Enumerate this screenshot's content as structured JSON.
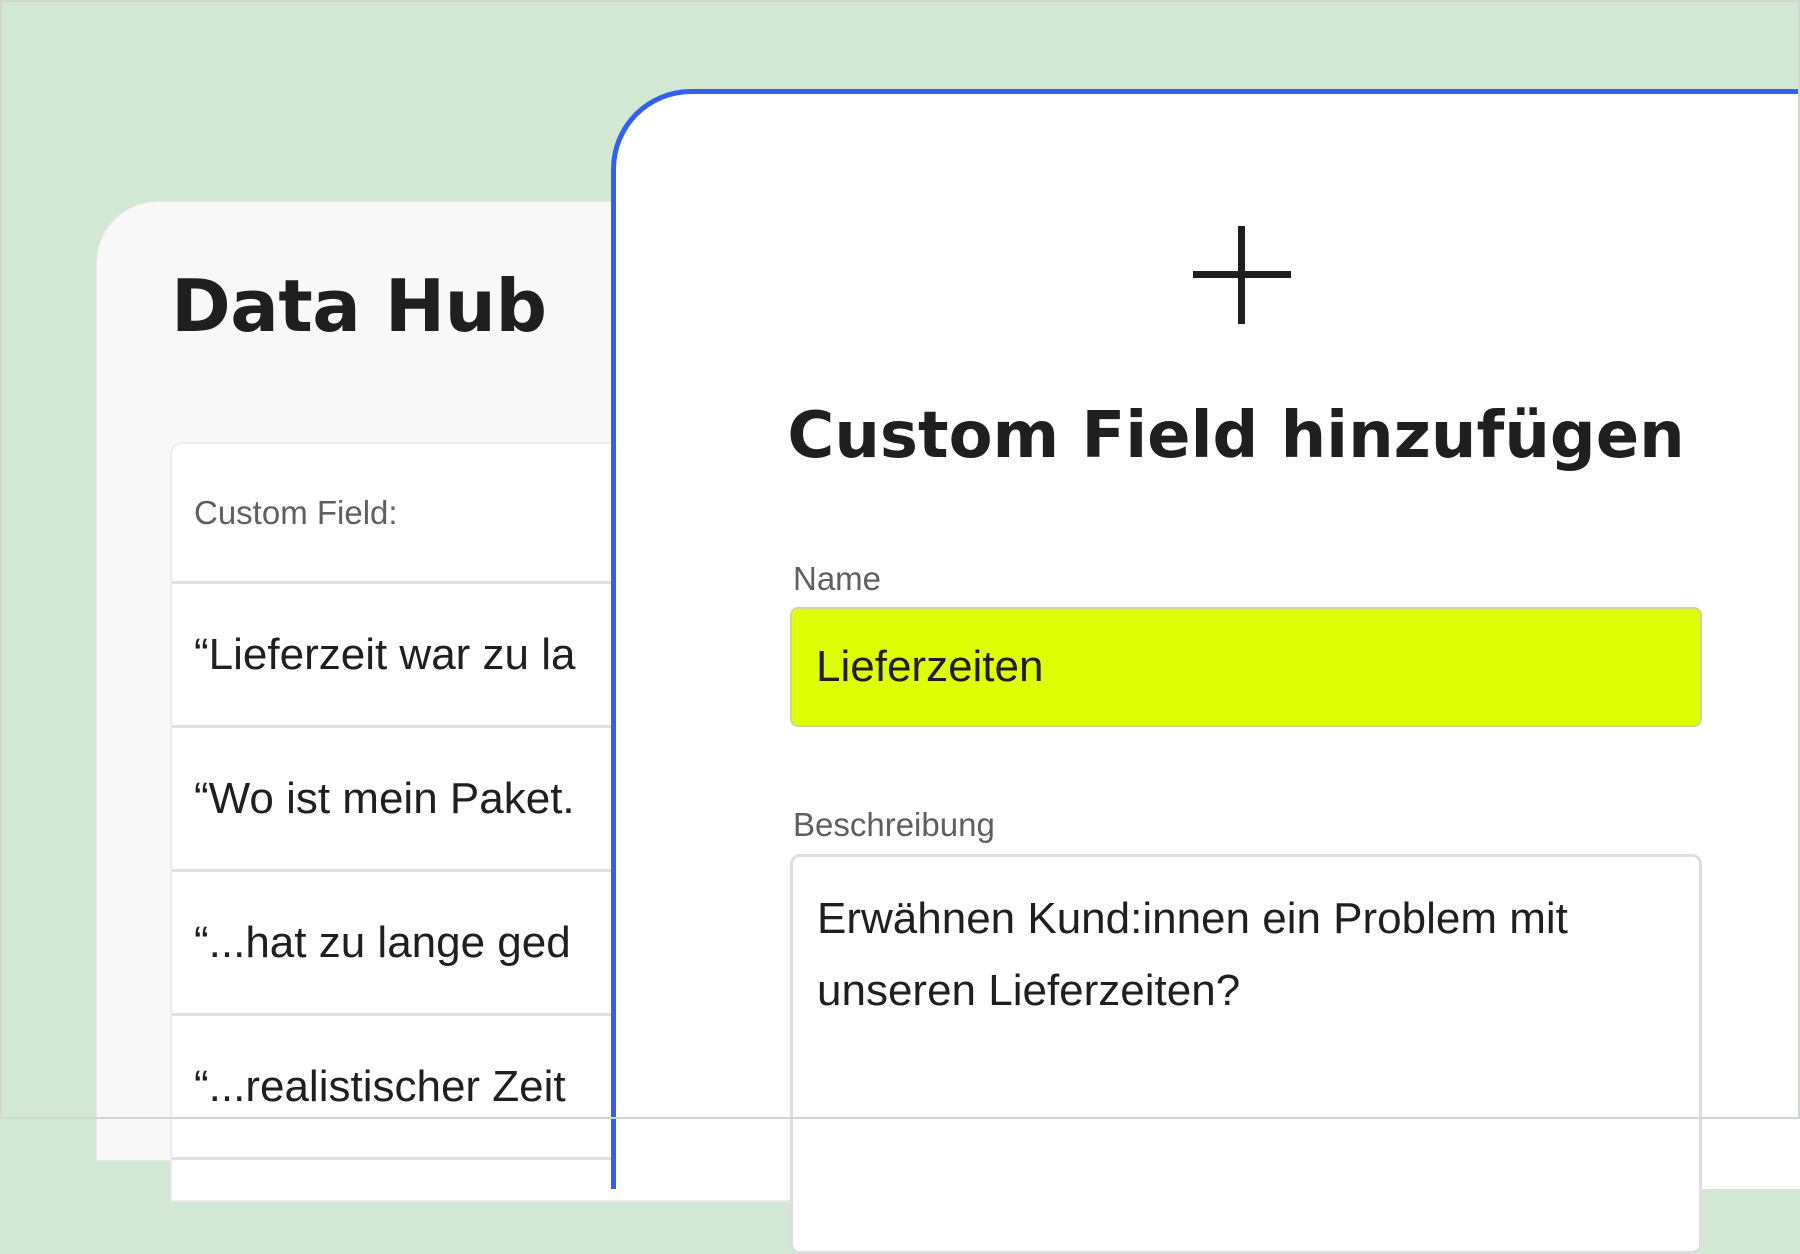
{
  "data_hub": {
    "title": "Data Hub",
    "column_header": "Custom Field:",
    "rows": [
      "“Lieferzeit war zu la",
      "“Wo ist mein Paket.",
      "“...hat zu lange ged",
      "“...realistischer Zeit"
    ]
  },
  "modal": {
    "title": "Custom Field hinzufügen",
    "name_label": "Name",
    "name_value": "Lieferzeiten",
    "description_label": "Beschreibung",
    "description_value": "Erwähnen Kund:innen ein Problem mit unseren Lieferzeiten?"
  },
  "colors": {
    "background": "#d2e7d4",
    "accent_border": "#3260f4",
    "highlight_input": "#dfff04"
  }
}
